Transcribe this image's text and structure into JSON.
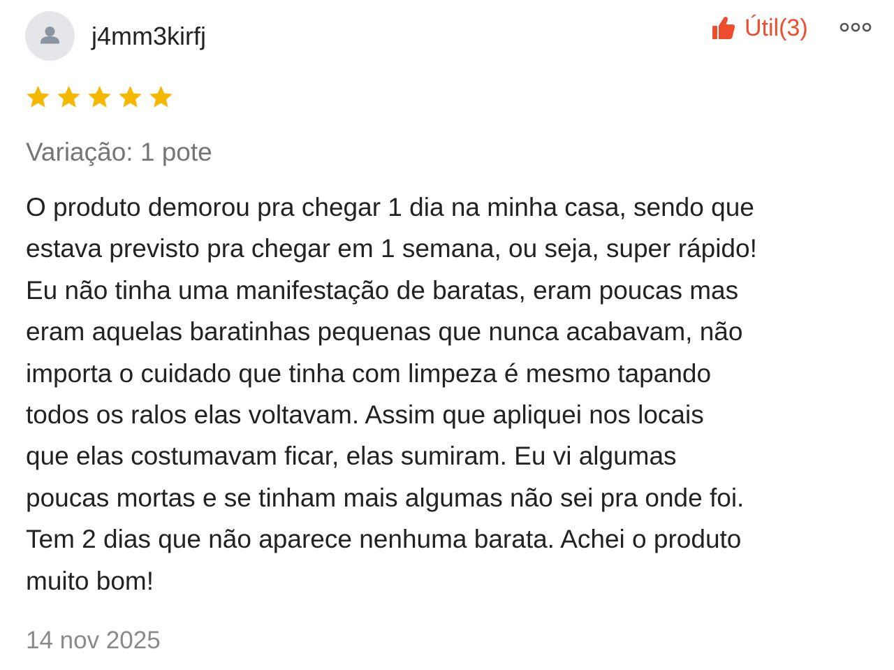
{
  "review": {
    "user": {
      "avatar_icon": "user-silhouette-icon",
      "username": "j4mm3kirfj"
    },
    "helpful": {
      "icon": "thumbs-up-icon",
      "label": "Útil(3)"
    },
    "more_menu_icon": "more-options-icon",
    "rating": {
      "stars": 5,
      "max": 5,
      "star_color": "#f5b800"
    },
    "variation": "Variação: 1 pote",
    "body_lines": [
      "O produto demorou pra chegar 1 dia na minha casa, sendo que",
      "estava previsto pra chegar em 1 semana, ou seja, super rápido!",
      "Eu não tinha uma manifestação de baratas, eram poucas mas",
      "eram aquelas baratinhas pequenas que nunca acabavam, não",
      "importa o cuidado que tinha com limpeza é mesmo tapando",
      "todos os ralos elas voltavam. Assim que apliquei nos locais",
      "que elas costumavam ficar, elas sumiram. Eu vi algumas",
      "poucas mortas e se tinham mais algumas não sei pra onde foi.",
      "Tem 2 dias que não aparece nenhuma barata. Achei o produto",
      "muito bom!"
    ],
    "date": "14 nov 2025"
  },
  "colors": {
    "accent": "#ee4d2d",
    "text": "#222222",
    "muted": "#757575",
    "avatar_bg": "#e4e6ea",
    "avatar_fg": "#8b95a1"
  }
}
